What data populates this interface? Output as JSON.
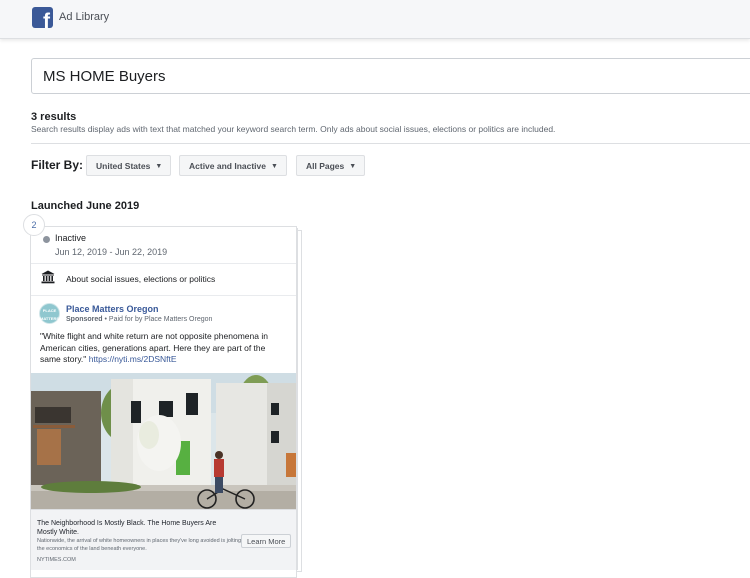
{
  "header": {
    "title": "Ad Library",
    "logo_glyph": "f",
    "brand_color": "#3b5998"
  },
  "search": {
    "value": "MS HOME Buyers"
  },
  "results": {
    "count_label": "3 results",
    "note": "Search results display ads with text that matched your keyword search term. Only ads about social issues, elections or politics are included."
  },
  "filters": {
    "label": "Filter By:",
    "items": [
      {
        "label": "United States"
      },
      {
        "label": "Active and Inactive"
      },
      {
        "label": "All Pages"
      }
    ]
  },
  "group": {
    "heading": "Launched June 2019",
    "count": "2"
  },
  "ad": {
    "status": "Inactive",
    "date_range": "Jun 12, 2019 - Jun 22, 2019",
    "category": "About social issues, elections or politics",
    "page_name": "Place Matters Oregon",
    "avatar_text": "PLACE MATTERS",
    "sponsored": "Sponsored",
    "paid_for": " • Paid for by Place Matters Oregon",
    "body": "\"White flight and white return are not opposite phenomena in American cities, generations apart. Here they are part of the same story.\" ",
    "body_link": "https://nyti.ms/2DSNftE",
    "headline": "The Neighborhood Is Mostly Black. The Home Buyers Are Mostly White.",
    "description": "Nationwide, the arrival of white homeowners in places they've long avoided is jolting the economics of the land beneath everyone.",
    "domain": "NYTIMES.COM",
    "cta": "Learn More"
  }
}
